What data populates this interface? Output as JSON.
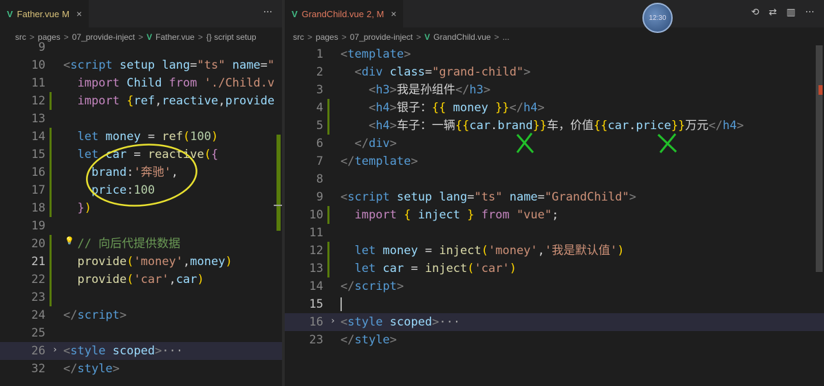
{
  "left": {
    "tab": {
      "icon": "vue-file-icon",
      "name": "Father.vue",
      "badge": "M",
      "close": "×"
    },
    "actions": "···",
    "breadcrumb": [
      "src",
      "pages",
      "07_provide-inject",
      "Father.vue",
      "{} script setup"
    ],
    "lines": [
      {
        "n": "9",
        "parts": []
      },
      {
        "n": "10",
        "parts": [
          [
            "t-tag",
            "<"
          ],
          [
            "t-el",
            "script"
          ],
          [
            "t-at",
            " setup"
          ],
          [
            "t-at",
            " lang"
          ],
          [
            "t-tx",
            "="
          ],
          [
            "t-st",
            "\"ts\""
          ],
          [
            "t-at",
            " name"
          ],
          [
            "t-tx",
            "="
          ],
          [
            "t-st",
            "\""
          ]
        ]
      },
      {
        "n": "11",
        "parts": [
          [
            "t-kw",
            "  import"
          ],
          [
            "t-id",
            " Child"
          ],
          [
            "t-kw",
            " from"
          ],
          [
            "t-st",
            " './Child.v"
          ]
        ]
      },
      {
        "n": "12",
        "parts": [
          [
            "t-kw",
            "  import"
          ],
          [
            "t-br",
            " {"
          ],
          [
            "t-id",
            "ref"
          ],
          [
            "t-tx",
            ","
          ],
          [
            "t-id",
            "reactive"
          ],
          [
            "t-tx",
            ","
          ],
          [
            "t-id",
            "provide"
          ]
        ]
      },
      {
        "n": "13",
        "parts": []
      },
      {
        "n": "14",
        "parts": [
          [
            "t-vb",
            "  let"
          ],
          [
            "t-id",
            " money"
          ],
          [
            "t-tx",
            " = "
          ],
          [
            "t-fn",
            "ref"
          ],
          [
            "t-br",
            "("
          ],
          [
            "t-nm",
            "100"
          ],
          [
            "t-br",
            ")"
          ]
        ]
      },
      {
        "n": "15",
        "parts": [
          [
            "t-vb",
            "  let"
          ],
          [
            "t-id",
            " car"
          ],
          [
            "t-tx",
            " = "
          ],
          [
            "t-fn",
            "reactive"
          ],
          [
            "t-br",
            "("
          ],
          [
            "t-kw",
            "{"
          ]
        ]
      },
      {
        "n": "16",
        "parts": [
          [
            "t-id",
            "    brand"
          ],
          [
            "t-tx",
            ":"
          ],
          [
            "t-st",
            "'奔驰'"
          ],
          [
            "t-tx",
            ","
          ]
        ]
      },
      {
        "n": "17",
        "parts": [
          [
            "t-id",
            "    price"
          ],
          [
            "t-tx",
            ":"
          ],
          [
            "t-nm",
            "100"
          ]
        ]
      },
      {
        "n": "18",
        "parts": [
          [
            "t-kw",
            "  }"
          ],
          [
            "t-br",
            ")"
          ]
        ]
      },
      {
        "n": "19",
        "parts": []
      },
      {
        "n": "20",
        "parts": [
          [
            "t-cm",
            "  // 向后代提供数据"
          ]
        ]
      },
      {
        "n": "21",
        "parts": [
          [
            "t-fn",
            "  provide"
          ],
          [
            "t-br",
            "("
          ],
          [
            "t-st",
            "'money'"
          ],
          [
            "t-tx",
            ","
          ],
          [
            "t-id",
            "money"
          ],
          [
            "t-br",
            ")"
          ]
        ]
      },
      {
        "n": "22",
        "parts": [
          [
            "t-fn",
            "  provide"
          ],
          [
            "t-br",
            "("
          ],
          [
            "t-st",
            "'car'"
          ],
          [
            "t-tx",
            ","
          ],
          [
            "t-id",
            "car"
          ],
          [
            "t-br",
            ")"
          ]
        ]
      },
      {
        "n": "23",
        "parts": []
      },
      {
        "n": "24",
        "parts": [
          [
            "t-tag",
            "</"
          ],
          [
            "t-el",
            "script"
          ],
          [
            "t-tag",
            ">"
          ]
        ]
      },
      {
        "n": "25",
        "parts": []
      },
      {
        "n": "26",
        "parts": [
          [
            "t-tag",
            "<"
          ],
          [
            "t-el",
            "style"
          ],
          [
            "t-at",
            " scoped"
          ],
          [
            "t-tag",
            ">"
          ],
          [
            "ellipsis",
            "···"
          ]
        ]
      },
      {
        "n": "32",
        "parts": [
          [
            "t-tag",
            "</"
          ],
          [
            "t-el",
            "style"
          ],
          [
            "t-tag",
            ">"
          ]
        ]
      }
    ]
  },
  "right": {
    "tab": {
      "icon": "vue-file-icon",
      "name": "GrandChild.vue",
      "badge": "2, M",
      "close": "×"
    },
    "avatar_text": "12:30",
    "breadcrumb": [
      "src",
      "pages",
      "07_provide-inject",
      "GrandChild.vue",
      "..."
    ],
    "lines": [
      {
        "n": "1",
        "parts": [
          [
            "t-tag",
            "<"
          ],
          [
            "t-el",
            "template"
          ],
          [
            "t-tag",
            ">"
          ]
        ]
      },
      {
        "n": "2",
        "parts": [
          [
            "t-tag",
            "  <"
          ],
          [
            "t-el",
            "div"
          ],
          [
            "t-at",
            " class"
          ],
          [
            "t-tx",
            "="
          ],
          [
            "t-st",
            "\"grand-child\""
          ],
          [
            "t-tag",
            ">"
          ]
        ]
      },
      {
        "n": "3",
        "parts": [
          [
            "t-tag",
            "    <"
          ],
          [
            "t-el",
            "h3"
          ],
          [
            "t-tag",
            ">"
          ],
          [
            "t-tx",
            "我是孙组件"
          ],
          [
            "t-tag",
            "</"
          ],
          [
            "t-el",
            "h3"
          ],
          [
            "t-tag",
            ">"
          ]
        ]
      },
      {
        "n": "4",
        "parts": [
          [
            "t-tag",
            "    <"
          ],
          [
            "t-el",
            "h4"
          ],
          [
            "t-tag",
            ">"
          ],
          [
            "t-tx",
            "银子："
          ],
          [
            "t-br",
            "{{"
          ],
          [
            "t-id",
            " money "
          ],
          [
            "t-br",
            "}}"
          ],
          [
            "t-tag",
            "</"
          ],
          [
            "t-el",
            "h4"
          ],
          [
            "t-tag",
            ">"
          ]
        ]
      },
      {
        "n": "5",
        "parts": [
          [
            "t-tag",
            "    <"
          ],
          [
            "t-el",
            "h4"
          ],
          [
            "t-tag",
            ">"
          ],
          [
            "t-tx",
            "车子：一辆"
          ],
          [
            "t-br",
            "{{"
          ],
          [
            "t-id",
            "car"
          ],
          [
            "t-tx",
            "."
          ],
          [
            "t-id",
            "brand"
          ],
          [
            "t-br",
            "}}"
          ],
          [
            "t-tx",
            "车，价值"
          ],
          [
            "t-br",
            "{{"
          ],
          [
            "t-id",
            "car"
          ],
          [
            "t-tx",
            "."
          ],
          [
            "t-id",
            "price"
          ],
          [
            "t-br",
            "}}"
          ],
          [
            "t-tx",
            "万元"
          ],
          [
            "t-tag",
            "</"
          ],
          [
            "t-el",
            "h4"
          ],
          [
            "t-tag",
            ">"
          ]
        ]
      },
      {
        "n": "6",
        "parts": [
          [
            "t-tag",
            "  </"
          ],
          [
            "t-el",
            "div"
          ],
          [
            "t-tag",
            ">"
          ]
        ]
      },
      {
        "n": "7",
        "parts": [
          [
            "t-tag",
            "</"
          ],
          [
            "t-el",
            "template"
          ],
          [
            "t-tag",
            ">"
          ]
        ]
      },
      {
        "n": "8",
        "parts": []
      },
      {
        "n": "9",
        "parts": [
          [
            "t-tag",
            "<"
          ],
          [
            "t-el",
            "script"
          ],
          [
            "t-at",
            " setup"
          ],
          [
            "t-at",
            " lang"
          ],
          [
            "t-tx",
            "="
          ],
          [
            "t-st",
            "\"ts\""
          ],
          [
            "t-at",
            " name"
          ],
          [
            "t-tx",
            "="
          ],
          [
            "t-st",
            "\"GrandChild\""
          ],
          [
            "t-tag",
            ">"
          ]
        ]
      },
      {
        "n": "10",
        "parts": [
          [
            "t-kw",
            "  import"
          ],
          [
            "t-br",
            " {"
          ],
          [
            "t-id",
            " inject "
          ],
          [
            "t-br",
            "}"
          ],
          [
            "t-kw",
            " from"
          ],
          [
            "t-st",
            " \"vue\""
          ],
          [
            "t-tx",
            ";"
          ]
        ]
      },
      {
        "n": "11",
        "parts": []
      },
      {
        "n": "12",
        "parts": [
          [
            "t-vb",
            "  let"
          ],
          [
            "t-id",
            " money"
          ],
          [
            "t-tx",
            " = "
          ],
          [
            "t-fn",
            "inject"
          ],
          [
            "t-br",
            "("
          ],
          [
            "t-st",
            "'money'"
          ],
          [
            "t-tx",
            ","
          ],
          [
            "t-st",
            "'我是默认值'"
          ],
          [
            "t-br",
            ")"
          ]
        ]
      },
      {
        "n": "13",
        "parts": [
          [
            "t-vb",
            "  let"
          ],
          [
            "t-id",
            " car"
          ],
          [
            "t-tx",
            " = "
          ],
          [
            "t-fn",
            "inject"
          ],
          [
            "t-br",
            "("
          ],
          [
            "t-st",
            "'car'"
          ],
          [
            "t-br",
            ")"
          ]
        ]
      },
      {
        "n": "14",
        "parts": [
          [
            "t-tag",
            "</"
          ],
          [
            "t-el",
            "script"
          ],
          [
            "t-tag",
            ">"
          ]
        ]
      },
      {
        "n": "15",
        "parts": []
      },
      {
        "n": "16",
        "parts": [
          [
            "t-tag",
            "<"
          ],
          [
            "t-el",
            "style"
          ],
          [
            "t-at",
            " scoped"
          ],
          [
            "t-tag",
            ">"
          ],
          [
            "ellipsis",
            "···"
          ]
        ]
      },
      {
        "n": "23",
        "parts": [
          [
            "t-tag",
            "</"
          ],
          [
            "t-el",
            "style"
          ],
          [
            "t-tag",
            ">"
          ]
        ]
      }
    ]
  },
  "icons": [
    "vue-file-icon",
    "history-icon",
    "compare-icon",
    "split-editor-icon",
    "more-actions-icon",
    "lightbulb-icon",
    "fold-chevron-icon"
  ],
  "colors": {
    "accent_vue": "#41b883",
    "modified": "#d9c27a",
    "annotation_circle": "#e8e030",
    "annotation_cross": "#22c02a"
  }
}
